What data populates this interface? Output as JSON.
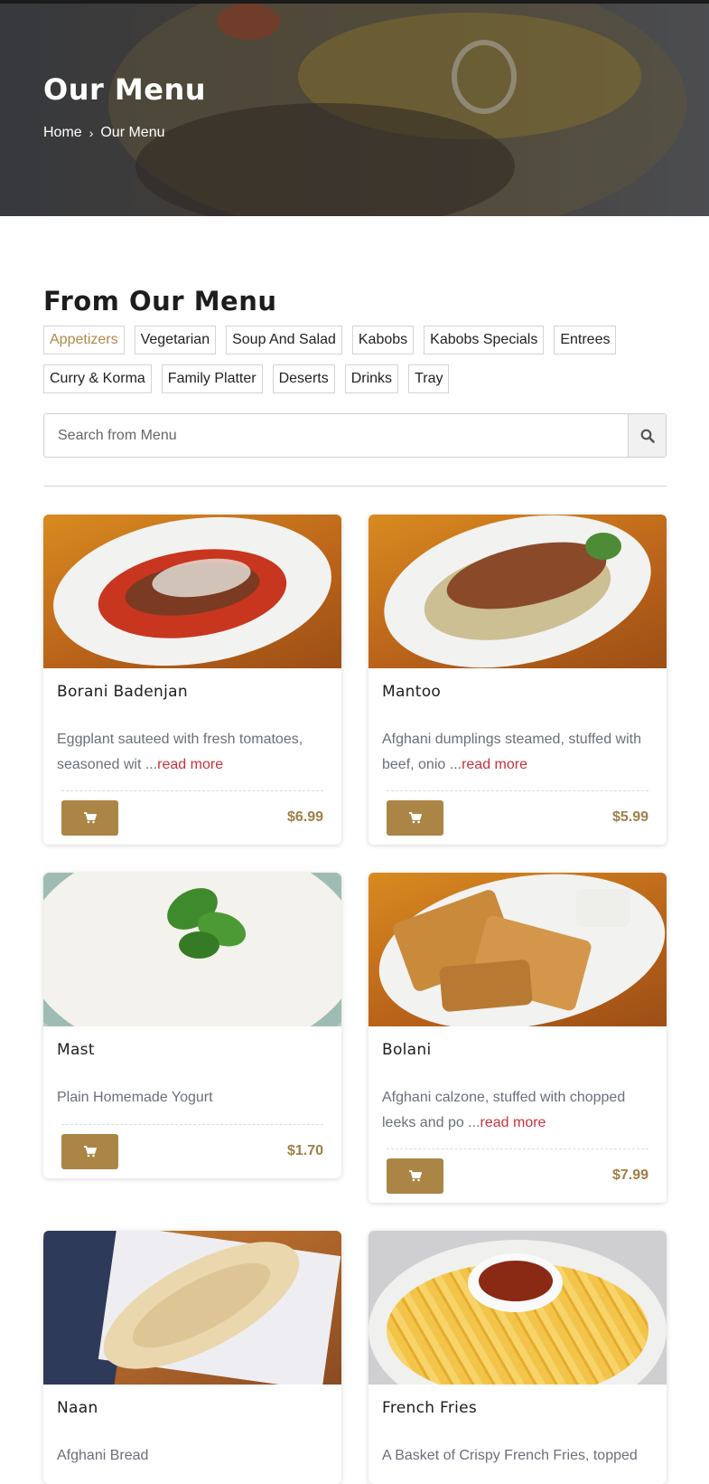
{
  "hero": {
    "title": "Our Menu",
    "breadcrumb": {
      "home": "Home",
      "separator": "›",
      "current": "Our Menu"
    }
  },
  "section": {
    "title": "From Our Menu"
  },
  "categories": [
    "Appetizers",
    "Vegetarian",
    "Soup And Salad",
    "Kabobs",
    "Kabobs Specials",
    "Entrees",
    "Curry & Korma",
    "Family Platter",
    "Deserts",
    "Drinks",
    "Tray"
  ],
  "active_category": "Appetizers",
  "search": {
    "placeholder": "Search from Menu",
    "icon": "search-icon"
  },
  "items": [
    {
      "name": "Borani Badenjan",
      "desc": "Eggplant sauteed with fresh tomatoes, seasoned wit ...",
      "more": "read more",
      "price": "$6.99",
      "image": "borani-badenjan-photo"
    },
    {
      "name": "Mantoo",
      "desc": "Afghani dumplings steamed, stuffed with beef, onio ...",
      "more": "read more",
      "price": "$5.99",
      "image": "mantoo-photo"
    },
    {
      "name": "Mast",
      "desc": "Plain Homemade Yogurt",
      "more": "",
      "price": "$1.70",
      "image": "mast-photo"
    },
    {
      "name": "Bolani",
      "desc": "Afghani calzone, stuffed with chopped leeks and po ...",
      "more": "read more",
      "price": "$7.99",
      "image": "bolani-photo"
    },
    {
      "name": "Naan",
      "desc": "Afghani Bread",
      "more": "",
      "price": "",
      "image": "naan-photo"
    },
    {
      "name": "French Fries",
      "desc": "A Basket of Crispy French Fries, topped",
      "more": "",
      "price": "",
      "image": "french-fries-photo"
    }
  ],
  "colors": {
    "accent": "#ab8546",
    "price": "#a07f46",
    "read_more": "#c8323a",
    "active_category": "#b08a4a"
  }
}
